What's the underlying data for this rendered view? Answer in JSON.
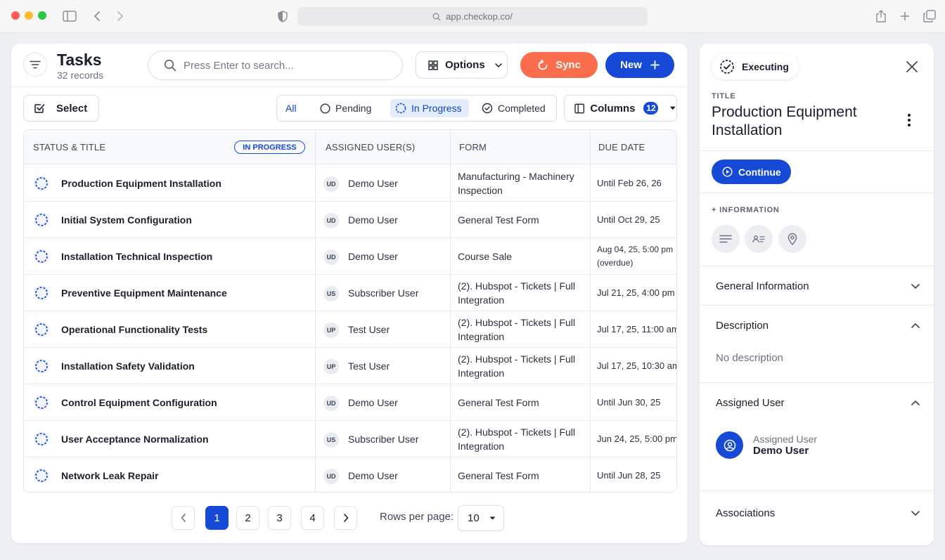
{
  "browser": {
    "url": "app.checkop.co/"
  },
  "header": {
    "title": "Tasks",
    "subtitle": "32 records",
    "search_placeholder": "Press Enter to search...",
    "options_label": "Options",
    "sync_label": "Sync",
    "new_label": "New",
    "sync_color": "#fb6e4d",
    "primary_color": "#1549d6"
  },
  "toolbar": {
    "select_label": "Select",
    "filters": [
      {
        "label": "All",
        "active": false
      },
      {
        "label": "Pending",
        "active": false
      },
      {
        "label": "In Progress",
        "active": true
      },
      {
        "label": "Completed",
        "active": false
      }
    ],
    "columns_label": "Columns",
    "columns_count": "12"
  },
  "table": {
    "headers": [
      "STATUS & TITLE",
      "ASSIGNED USER(S)",
      "FORM",
      "DUE DATE"
    ],
    "status_pill": "IN PROGRESS",
    "rows": [
      {
        "title": "Production Equipment Installation",
        "initials": "UD",
        "user": "Demo User",
        "form": "Manufacturing - Machinery Inspection",
        "due": "Until Feb 26, 26"
      },
      {
        "title": "Initial System Configuration",
        "initials": "UD",
        "user": "Demo User",
        "form": "General Test Form",
        "due": "Until Oct 29, 25"
      },
      {
        "title": "Installation Technical Inspection",
        "initials": "UD",
        "user": "Demo User",
        "form": "Course Sale",
        "due": "Aug 04, 25, 5:00 pm (overdue)"
      },
      {
        "title": "Preventive Equipment Maintenance",
        "initials": "US",
        "user": "Subscriber User",
        "form": "(2). Hubspot - Tickets | Full Integration",
        "due": "Jul 21, 25, 4:00 pm"
      },
      {
        "title": "Operational Functionality Tests",
        "initials": "UP",
        "user": "Test User",
        "form": "(2). Hubspot - Tickets | Full Integration",
        "due": "Jul 17, 25, 11:00 am"
      },
      {
        "title": "Installation Safety Validation",
        "initials": "UP",
        "user": "Test User",
        "form": "(2). Hubspot - Tickets | Full Integration",
        "due": "Jul 17, 25, 10:30 am"
      },
      {
        "title": "Control Equipment Configuration",
        "initials": "UD",
        "user": "Demo User",
        "form": "General Test Form",
        "due": "Until Jun 30, 25"
      },
      {
        "title": "User Acceptance Normalization",
        "initials": "US",
        "user": "Subscriber User",
        "form": "(2). Hubspot - Tickets | Full Integration",
        "due": "Jun 24, 25, 5:00 pm"
      },
      {
        "title": "Network Leak Repair",
        "initials": "UD",
        "user": "Demo User",
        "form": "General Test Form",
        "due": "Until Jun 28, 25"
      }
    ]
  },
  "pagination": {
    "pages": [
      "1",
      "2",
      "3",
      "4"
    ],
    "current": "1",
    "rows_per_page_label": "Rows per page:",
    "rows_per_page": "10"
  },
  "detail": {
    "status": "Executing",
    "title_label": "TITLE",
    "title": "Production Equipment Installation",
    "continue_label": "Continue",
    "information_label": "+ INFORMATION",
    "sections": {
      "general": "General Information",
      "description": "Description",
      "description_text": "No description",
      "assigned": "Assigned User",
      "assigned_label": "Assigned User",
      "assigned_name": "Demo User",
      "associations": "Associations"
    }
  },
  "icons": {
    "filter": "filter-icon",
    "search": "search-icon",
    "options": "grid-icon",
    "sync": "sync-icon",
    "new": "plus-icon",
    "status": "in-progress-circle-icon"
  }
}
